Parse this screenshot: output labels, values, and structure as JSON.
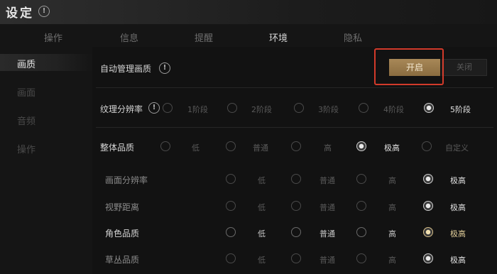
{
  "window": {
    "title": "设定",
    "info_icon": "!"
  },
  "tabs": [
    {
      "label": "操作"
    },
    {
      "label": "信息"
    },
    {
      "label": "提醒"
    },
    {
      "label": "环境",
      "active": true
    },
    {
      "label": "隐私"
    }
  ],
  "sidebar": {
    "items": [
      {
        "label": "画质",
        "active": true
      },
      {
        "label": "画面"
      },
      {
        "label": "音频"
      },
      {
        "label": "操作"
      }
    ]
  },
  "settings": {
    "auto_quality": {
      "label": "自动管理画质",
      "info_icon": "!",
      "on_label": "开启",
      "off_label": "关闭",
      "value": "开启"
    },
    "texture": {
      "label": "纹理分辨率",
      "info_icon": "!",
      "options": [
        "1阶段",
        "2阶段",
        "3阶段",
        "4阶段",
        "5阶段"
      ],
      "selected": "5阶段"
    },
    "overall": {
      "label": "整体品质",
      "options": [
        "低",
        "普通",
        "高",
        "极高",
        "自定义"
      ],
      "selected": "极高"
    },
    "screen_res": {
      "label": "画面分辨率",
      "options": [
        "低",
        "普通",
        "高",
        "极高"
      ],
      "selected": "极高"
    },
    "view_dist": {
      "label": "视野距离",
      "options": [
        "低",
        "普通",
        "高",
        "极高"
      ],
      "selected": "极高"
    },
    "char_quality": {
      "label": "角色品质",
      "options": [
        "低",
        "普通",
        "高",
        "极高"
      ],
      "selected": "极高"
    },
    "grass_quality": {
      "label": "草丛品质",
      "options": [
        "低",
        "普通",
        "高",
        "极高"
      ],
      "selected": "极高"
    }
  },
  "colors": {
    "accent_gold": "#a88858",
    "highlight_red": "#d23a2a",
    "background": "#151515"
  }
}
